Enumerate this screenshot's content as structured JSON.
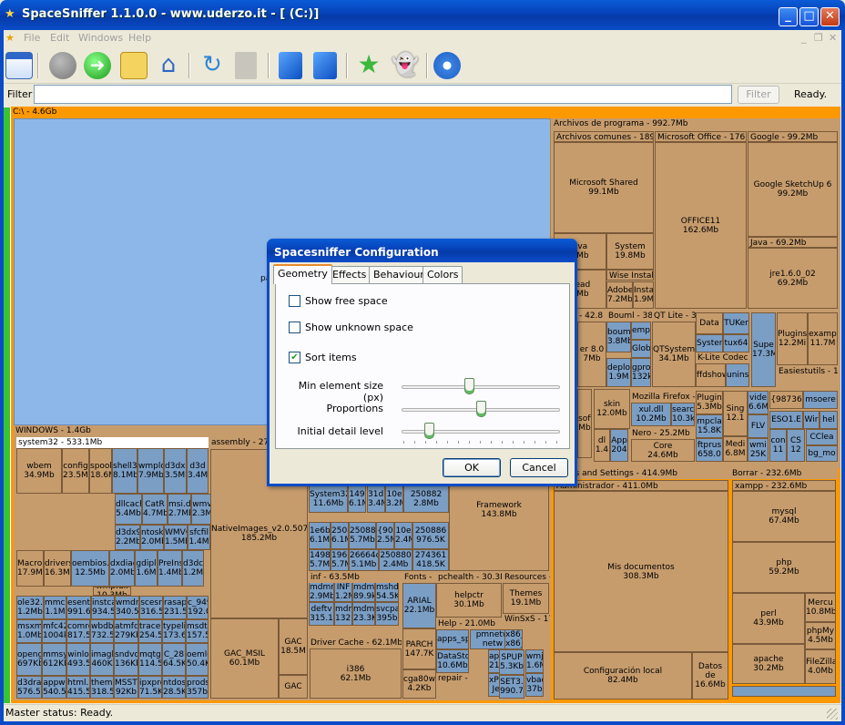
{
  "window": {
    "title": "SpaceSniffer 1.1.0.0 - www.uderzo.it - [ (C:)]"
  },
  "menu": [
    "File",
    "Edit",
    "Windows",
    "Help"
  ],
  "toolbar_icons": [
    "new-view-icon",
    "stop-icon",
    "go-icon",
    "open-folder-icon",
    "home-icon",
    "refresh-icon",
    "document-icon",
    "blue-cube-icon",
    "blue-cube-icon",
    "star-icon",
    "ghost-icon",
    "settings-icon"
  ],
  "filter": {
    "label": "Filter",
    "value": "",
    "button": "Filter",
    "status": "Ready."
  },
  "treemap": {
    "root": "C:\\ - 4.6Gb",
    "pagefile": "pa",
    "windows": "WINDOWS - 1.4Gb",
    "system32": "system32 - 533.1Mb",
    "assembly": "assembly - 270",
    "native_images": [
      "NativeImages_v2.0.507",
      "185.2Mb"
    ],
    "gac_msil": [
      "GAC_MSIL",
      "60.1Mb"
    ],
    "gac2": [
      "GAC",
      "18.5M"
    ],
    "gac3": "GAC",
    "framework": [
      "Framework",
      "143.8Mb"
    ],
    "system32b": [
      "System32",
      "11.6Mb"
    ],
    "inf": "inf - 63.5Mb",
    "fonts": "Fonts -",
    "arial": [
      "ARIAL",
      "22.1Mb"
    ],
    "pchealth": "pchealth - 30.3M",
    "helpctr": [
      "helpctr",
      "30.1Mb"
    ],
    "resources": "Resources -",
    "themes": [
      "Themes",
      "19.1Mb"
    ],
    "driver_cache": "Driver Cache - 62.1Mb",
    "i386": [
      "i386",
      "62.1Mb"
    ],
    "help": "Help - 21.0Mb",
    "winsxs": "WinSxS - 17",
    "parch": [
      "PARCH",
      "147.7K"
    ],
    "cga80": [
      "cga80w",
      "4.2Kb"
    ],
    "datasto": [
      "DataStor",
      "10.6Mb"
    ],
    "apps": "apps_sp",
    "repair": "repair - 9",
    "spup": [
      "SPUP",
      "5.3Kb"
    ],
    "set3": [
      "SET3.",
      "990.7"
    ],
    "archivos": "Archivos de programa - 992.7Mb",
    "comunes": "Archivos comunes - 189.5",
    "ms_shared": [
      "Microsoft Shared",
      "99.1Mb"
    ],
    "java_a": [
      "ava",
      "5Mb"
    ],
    "system_a": [
      "System",
      "19.8Mb"
    ],
    "wise": "Wise Install",
    "adobe": [
      "Adobe",
      "7.2Mb"
    ],
    "insta": [
      "Insta",
      "1.9M"
    ],
    "head": [
      "head",
      "6Mb"
    ],
    "ms_office": "Microsoft Office - 176.4",
    "office11": [
      "OFFICE11",
      "162.6Mb"
    ],
    "google": "Google - 99.2Mb",
    "sketchup": [
      "Google SketchUp 6",
      "99.2Mb"
    ],
    "java": "Java - 69.2Mb",
    "jre": [
      "jre1.6.0_02",
      "69.2Mb"
    ],
    "b428": "- 42.8",
    "bouml": "Bouml - 38.",
    "qtlite": "QT Lite - 3",
    "er80": [
      "er 8.0",
      "7Mb"
    ],
    "bouml2": [
      "bouml",
      "3.8Mb"
    ],
    "emp": "emp",
    "glob": "Glob",
    "deplo": [
      "deplo",
      "1.9M"
    ],
    "gpro": [
      "gpro",
      "132k"
    ],
    "qtsystem": [
      "QTSystem",
      "34.1Mb"
    ],
    "data": "Data",
    "tuker": "TUKer",
    "syster": "Syster",
    "tux64": "tux64",
    "klite": "K-Lite Codec P",
    "ffdshow": "ffdshow",
    "unins": "unins",
    "supe": [
      "Supe",
      "17.3M"
    ],
    "plugins": [
      "Plugins",
      "12.2Mi"
    ],
    "examp": [
      "examp",
      "11.7M"
    ],
    "easiest": "Easiestutils - 14",
    "firefox": "Mozilla Firefox -",
    "xuldll": [
      "xul.dll",
      "10.2Mb"
    ],
    "searc": [
      "searc",
      "10.3k"
    ],
    "plugin2": [
      "Plugin",
      "5.3Mb"
    ],
    "mpcla": [
      "mpcla",
      "15.8K"
    ],
    "sing": [
      "Sing",
      "12.1"
    ],
    "vide": [
      "vide",
      "6.6M"
    ],
    "flv": "FLV",
    "b98736": "{98736",
    "msoere": "msoere",
    "eso1e": "ESO1.E",
    "wir": "Wir",
    "helv": "hel",
    "skin": [
      "skin",
      "12.0Mb"
    ],
    "nero": "Nero - 25.2Mb",
    "core": [
      "Core",
      "24.6Mb"
    ],
    "ftprus": [
      "ftprus",
      "658.0"
    ],
    "medi": [
      "Medi",
      "6.8M"
    ],
    "wmi": [
      "wmi",
      "25K"
    ],
    "con": [
      "con",
      "11"
    ],
    "cs": [
      "CS",
      "12"
    ],
    "cclea": "CClea",
    "bgmo": "bg_mo",
    "soft": [
      "soft",
      "Mb"
    ],
    "dl": [
      "dl",
      "1.4"
    ],
    "app": [
      "App",
      "204"
    ],
    "docs": "ments and Settings - 414.9Mb",
    "admin": "Administrador - 411.0Mb",
    "misdocs": [
      "Mis documentos",
      "308.3Mb"
    ],
    "conf_local": [
      "Configuración local",
      "82.4Mb"
    ],
    "datos": [
      "Datos de",
      "16.6Mb"
    ],
    "borrar": "Borrar - 232.6Mb",
    "xampp": "xampp - 232.6Mb",
    "mysql": [
      "mysql",
      "67.4Mb"
    ],
    "php": [
      "php",
      "59.2Mb"
    ],
    "perl": [
      "perl",
      "43.9Mb"
    ],
    "mercu": [
      "Mercu",
      "10.8Mb"
    ],
    "phpmy": [
      "phpMy",
      "4.5Mb"
    ],
    "apache": [
      "apache",
      "30.2Mb"
    ],
    "filezilla": [
      "FileZilla",
      "4.0Mb"
    ]
  },
  "sys32_cells": [
    [
      "wbem",
      "34.9Mb"
    ],
    [
      "config",
      "23.5Mb"
    ],
    [
      "spool",
      "18.6M"
    ],
    [
      "shell32",
      "8.1Mb"
    ],
    [
      "wmplo",
      "7.9Mb"
    ],
    [
      "d3dx9",
      "3.5Mb"
    ],
    [
      "d3d",
      "3.4M"
    ],
    [
      "dllcach",
      "5.4Mb"
    ],
    [
      "CatR",
      "4.7Mb"
    ],
    [
      "msi.dl",
      "2.7Mb"
    ],
    [
      "wmv",
      "2.3M"
    ],
    [
      "d3dx9",
      "2.2Mb"
    ],
    [
      "ntoskr",
      "2.0Mb"
    ],
    [
      "WMVC",
      "1.5Mb"
    ],
    [
      "sfcfil",
      "1.4M"
    ],
    [
      "Macrom",
      "17.9Mb"
    ],
    [
      "drivers",
      "16.3Mb"
    ],
    [
      "oembios.b",
      "12.5Mb"
    ],
    [
      "dxdiag",
      "2.0Mb"
    ],
    [
      "gdipl",
      "1.6M"
    ],
    [
      "PreIns",
      "1.4Mb"
    ],
    [
      "d3dc",
      "1.2M"
    ],
    [
      "wmp.dll",
      "10.3Mb"
    ],
    [
      "ole32.c",
      "1.2Mb"
    ],
    [
      "mmcr",
      "1.1M"
    ],
    [
      "esent",
      "991.6"
    ],
    [
      "instca",
      "934.5"
    ],
    [
      "wmdr",
      "340.5k"
    ],
    [
      "scesr",
      "316.5"
    ],
    [
      "rasapi",
      "231.5"
    ],
    [
      "c_949",
      "192.0"
    ],
    [
      "msxml",
      "1.0Mb"
    ],
    [
      "mfc42",
      "1004k"
    ],
    [
      "comre",
      "817.5"
    ],
    [
      "wbdb",
      "732.5"
    ],
    [
      "atmfd",
      "279Kb"
    ],
    [
      "tracer",
      "254.5"
    ],
    [
      "typeli",
      "173.6"
    ],
    [
      "msdtc",
      "157.5"
    ],
    [
      "openg",
      "697Kb"
    ],
    [
      "mmsy",
      "612Kb"
    ],
    [
      "winlo",
      "493.5k"
    ],
    [
      "imagl",
      "460K"
    ],
    [
      "sndvo",
      "136Kb"
    ],
    [
      "mqtgs",
      "114.5"
    ],
    [
      "C_28",
      "64.5Kb"
    ],
    [
      "oemlc",
      "50.4K"
    ],
    [
      "d3drar",
      "576.5k"
    ],
    [
      "appw",
      "540.5"
    ],
    [
      "html.i",
      "415.5k"
    ],
    [
      "themu",
      "318.5"
    ],
    [
      "MSSTI",
      "92Kb"
    ],
    [
      "ipxpro",
      "71.5K"
    ],
    [
      "ntdos",
      "28.5Kb"
    ],
    [
      "prodsp",
      "357b"
    ]
  ],
  "small_cells": [
    [
      "149",
      "6.1M"
    ],
    [
      "31dl",
      "3.4M"
    ],
    [
      "10e",
      "3.2M"
    ],
    [
      "250882",
      "2.8Mb"
    ],
    [
      "1e6b",
      "6.1M"
    ],
    [
      "2508",
      "6.1M"
    ],
    [
      "250885",
      "5.7Mb"
    ],
    [
      "{90",
      "2.5M"
    ],
    [
      "10e",
      "2.4M"
    ],
    [
      "250886",
      "976.5K"
    ],
    [
      "1498",
      "5.7M"
    ],
    [
      "1967",
      "5.7M"
    ],
    [
      "26664c",
      "5.1Mb"
    ],
    [
      "250880",
      "2.4Mb"
    ],
    [
      "274361",
      "418.5K"
    ],
    [
      "mdmr",
      "2.9Mb"
    ],
    [
      "INF",
      "1.2M"
    ],
    [
      "mdmi",
      "89.9k"
    ],
    [
      "mshd",
      "54.5K"
    ],
    [
      "deftv",
      "315.1"
    ],
    [
      "mdm",
      "132.9"
    ],
    [
      "mdmi",
      "23.3K"
    ],
    [
      "svcpa",
      "395b"
    ],
    [
      "pmnetw",
      "netw"
    ],
    [
      "x86_N",
      "x86_"
    ],
    [
      "apph",
      "212.8"
    ],
    [
      "wmj",
      "1.6M"
    ],
    [
      "xPize",
      "Jes"
    ],
    [
      "vbadd",
      "37b"
    ]
  ],
  "dialog": {
    "title": "Spacesniffer Configuration",
    "tabs": [
      "Geometry",
      "Effects",
      "Behaviour",
      "Colors"
    ],
    "checkboxes": [
      {
        "label": "Show free space",
        "checked": false
      },
      {
        "label": "Show unknown space",
        "checked": false
      },
      {
        "label": "Sort items",
        "checked": true
      }
    ],
    "checkmark": "✔",
    "sliders": [
      {
        "label": "Min element size (px)",
        "value": 0.42
      },
      {
        "label": "Proportions",
        "value": 0.5
      },
      {
        "label": "Initial detail level",
        "value": 0.15
      }
    ],
    "ok": "OK",
    "cancel": "Cancel"
  },
  "status": "Master status: Ready.",
  "colors": {
    "free": "#8db7e8",
    "folder": "#c69c6d",
    "file": "#7b9ec5",
    "highlight": "#fc9800"
  }
}
